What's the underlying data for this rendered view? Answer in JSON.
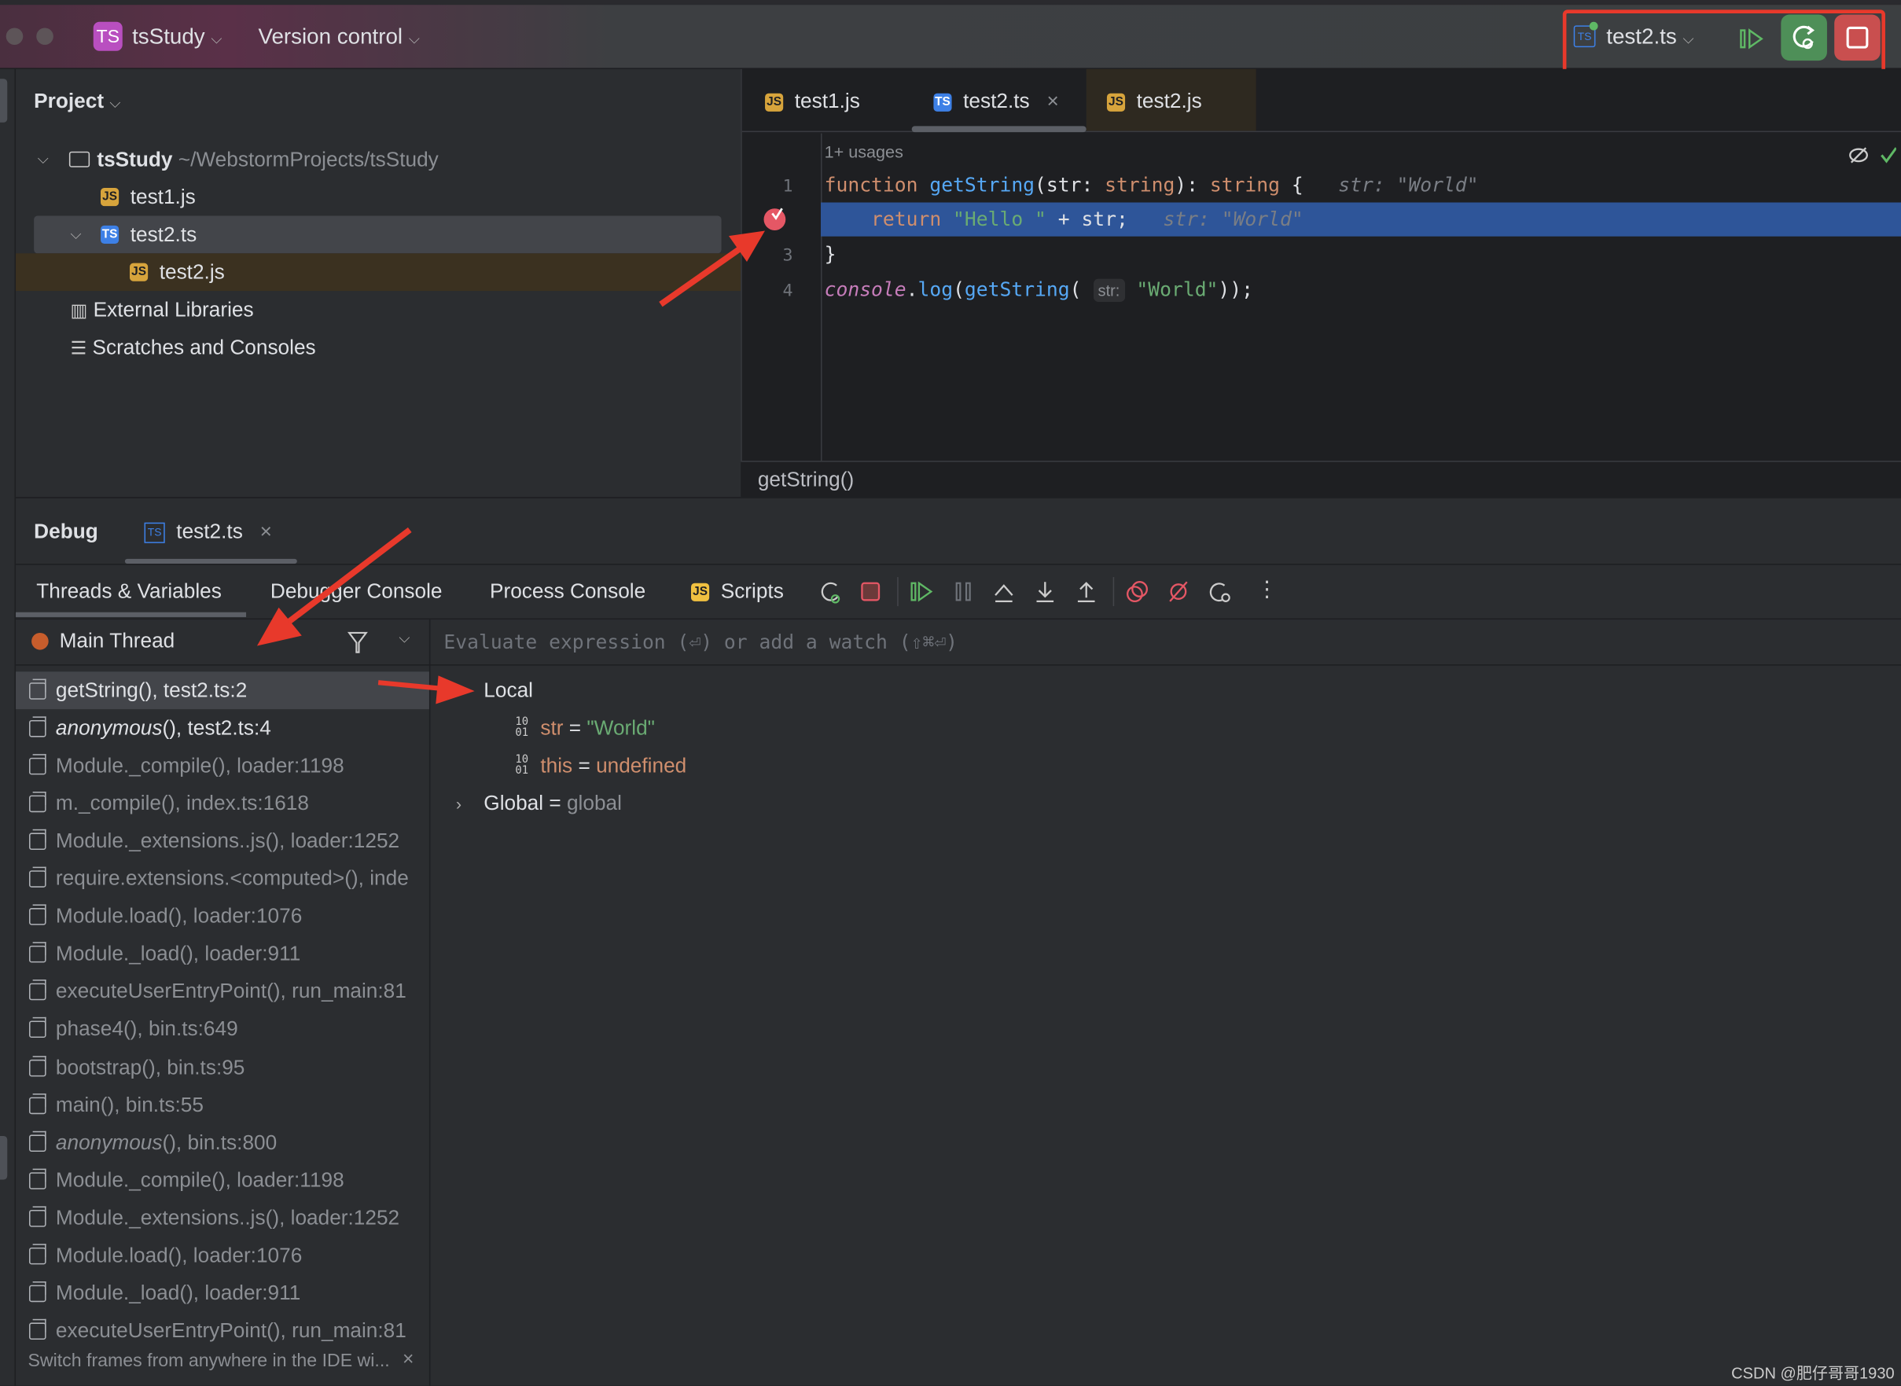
{
  "titlebar": {
    "project_badge": "TS",
    "project": "tsStudy",
    "vcs": "Version control",
    "run_config": "test2.ts",
    "icons": [
      "resume-icon",
      "debug-rerun-icon",
      "stop-icon"
    ],
    "colors": {
      "rerun": "#4e8f58",
      "stop": "#c94f4f",
      "highlight": "#e8392b"
    }
  },
  "project_panel": {
    "title": "Project",
    "root": {
      "name": "tsStudy",
      "path": "~/WebstormProjects/tsStudy"
    },
    "items": [
      {
        "name": "test1.js",
        "type": "js"
      },
      {
        "name": "test2.ts",
        "type": "ts"
      },
      {
        "name": "test2.js",
        "type": "js"
      },
      {
        "name": "External Libraries"
      },
      {
        "name": "Scratches and Consoles"
      }
    ]
  },
  "editor": {
    "tabs": [
      {
        "label": "test1.js",
        "type": "js"
      },
      {
        "label": "test2.ts",
        "type": "ts",
        "active": true,
        "close": "×"
      },
      {
        "label": "test2.js",
        "type": "js"
      }
    ],
    "usages": "1+ usages",
    "line_numbers": [
      "1",
      "3",
      "4"
    ],
    "lines": {
      "l1": {
        "kw": "function",
        "fn": "getString",
        "p1": "(str: ",
        "t1": "string",
        "p2": "): ",
        "t2": "string",
        "p3": " {",
        "hint": "str: \"World\""
      },
      "l2": {
        "kw": "return",
        "s": "\"Hello \"",
        "rest": " + str;",
        "hint": "str: \"World\""
      },
      "l3": "}",
      "l4": {
        "obj": "console",
        "dot": ".",
        "fn1": "log",
        "p": "(",
        "fn2": "getString",
        "p2": "(",
        "inlay": "str:",
        "s": "\"World\"",
        "end": "));"
      }
    },
    "breadcrumb": "getString()"
  },
  "debug": {
    "title": "Debug",
    "session_tab": "test2.ts",
    "close": "×",
    "tabs": [
      "Threads & Variables",
      "Debugger Console",
      "Process Console",
      "Scripts"
    ],
    "toolbar_icons": [
      "rerun-icon",
      "stop-icon",
      "resume-icon",
      "pause-icon",
      "step-over-icon",
      "step-into-icon",
      "step-out-icon",
      "view-breakpoints-icon",
      "mute-breakpoints-icon",
      "reset-frame-icon",
      "more-icon"
    ],
    "thread": "Main Thread",
    "eval_placeholder": "Evaluate expression (⏎) or add a watch (⇧⌘⏎)",
    "frames": [
      {
        "name": "getString",
        "rest": "(), test2.ts:2",
        "selected": true
      },
      {
        "name": "anonymous",
        "rest": "(), test2.ts:4",
        "italic": true,
        "bright": true
      },
      {
        "name": "Module._compile",
        "rest": "(), loader:1198"
      },
      {
        "name": "m._compile",
        "rest": "(), index.ts:1618"
      },
      {
        "name": "Module._extensions..js",
        "rest": "(), loader:1252"
      },
      {
        "name": "require.extensions.<computed>",
        "rest": "(), inde"
      },
      {
        "name": "Module.load",
        "rest": "(), loader:1076"
      },
      {
        "name": "Module._load",
        "rest": "(), loader:911"
      },
      {
        "name": "executeUserEntryPoint",
        "rest": "(), run_main:81"
      },
      {
        "name": "phase4",
        "rest": "(), bin.ts:649"
      },
      {
        "name": "bootstrap",
        "rest": "(), bin.ts:95"
      },
      {
        "name": "main",
        "rest": "(), bin.ts:55"
      },
      {
        "name": "anonymous",
        "rest": "(), bin.ts:800",
        "italic": true
      },
      {
        "name": "Module._compile",
        "rest": "(), loader:1198"
      },
      {
        "name": "Module._extensions..js",
        "rest": "(), loader:1252"
      },
      {
        "name": "Module.load",
        "rest": "(), loader:1076"
      },
      {
        "name": "Module._load",
        "rest": "(), loader:911"
      },
      {
        "name": "executeUserEntryPoint",
        "rest": "(), run_main:81"
      }
    ],
    "hint": "Switch frames from anywhere in the IDE wi...",
    "hint_close": "×",
    "variables": {
      "local": "Local",
      "vars": [
        {
          "name": "str",
          "eq": " = ",
          "value": "\"World\""
        },
        {
          "name": "this",
          "eq": " = ",
          "value": "undefined"
        }
      ],
      "global": {
        "name": "Global",
        "eq": " = ",
        "value": "global"
      }
    }
  },
  "watermark": "CSDN @肥仔哥哥1930"
}
